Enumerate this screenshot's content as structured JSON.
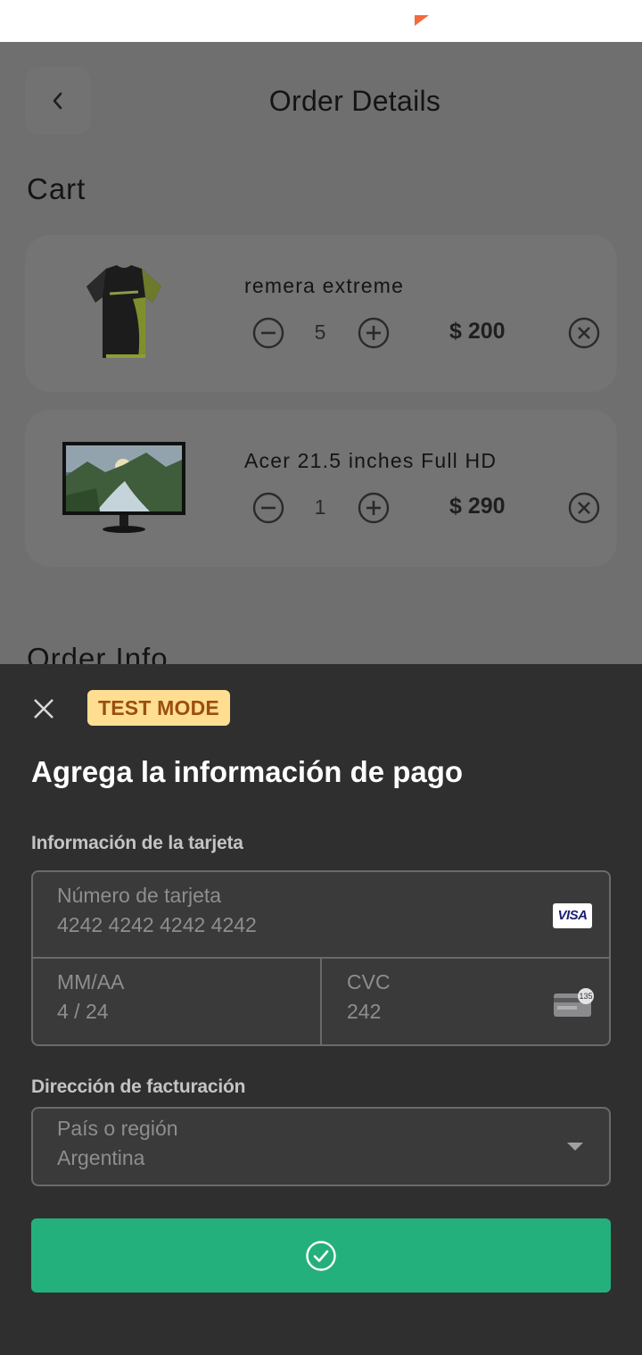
{
  "header": {
    "title": "Order Details",
    "back_icon": "chevron-left-icon"
  },
  "cart": {
    "title": "Cart",
    "items": [
      {
        "name": "remera extreme",
        "quantity": "5",
        "price": "$ 200",
        "image": "t-shirt-image"
      },
      {
        "name": "Acer 21.5 inches Full HD",
        "quantity": "1",
        "price": "$ 290",
        "image": "monitor-image"
      }
    ]
  },
  "order_info": {
    "title": "Order Info"
  },
  "payment_sheet": {
    "badge": "TEST MODE",
    "title": "Agrega la información de pago",
    "card_section_label": "Información de la tarjeta",
    "card_number": {
      "placeholder": "Número de tarjeta",
      "value": "4242 4242 4242 4242",
      "brand": "VISA"
    },
    "expiry": {
      "placeholder": "MM/AA",
      "value": "4 / 24"
    },
    "cvc": {
      "placeholder": "CVC",
      "value": "242",
      "icon_text": "135"
    },
    "billing_section_label": "Dirección de facturación",
    "country": {
      "placeholder": "País o región",
      "value": "Argentina"
    },
    "submit_icon": "check-circle-icon"
  },
  "colors": {
    "accent_green": "#24b07c",
    "badge_bg": "#ffde92",
    "badge_text": "#9a4f0e",
    "sheet_bg": "#2f2f30",
    "status_mark": "#f26a3d"
  }
}
